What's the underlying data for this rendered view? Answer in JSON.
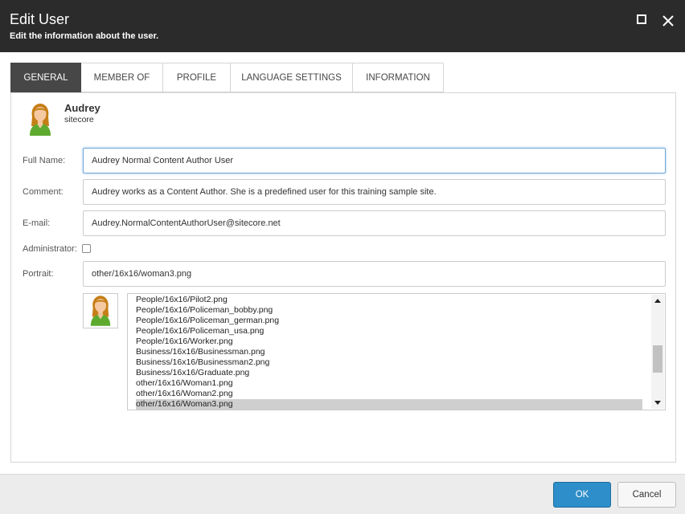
{
  "dialog": {
    "title": "Edit User",
    "subtitle": "Edit the information about the user."
  },
  "tabs": [
    {
      "label": "GENERAL",
      "active": true
    },
    {
      "label": "MEMBER OF"
    },
    {
      "label": "PROFILE"
    },
    {
      "label": "LANGUAGE SETTINGS"
    },
    {
      "label": "INFORMATION"
    }
  ],
  "user": {
    "name": "Audrey",
    "domain": "sitecore"
  },
  "form": {
    "full_name_label": "Full Name:",
    "full_name_value": "Audrey Normal Content Author User",
    "comment_label": "Comment:",
    "comment_value": "Audrey works as a Content Author. She is a predefined user for this training sample site.",
    "email_label": "E-mail:",
    "email_value": "Audrey.NormalContentAuthorUser@sitecore.net",
    "administrator_label": "Administrator:",
    "administrator_checked": false,
    "portrait_label": "Portrait:",
    "portrait_value": "other/16x16/woman3.png"
  },
  "portrait_list": {
    "items": [
      "People/16x16/Pilot2.png",
      "People/16x16/Policeman_bobby.png",
      "People/16x16/Policeman_german.png",
      "People/16x16/Policeman_usa.png",
      "People/16x16/Worker.png",
      "Business/16x16/Businessman.png",
      "Business/16x16/Businessman2.png",
      "Business/16x16/Graduate.png",
      "other/16x16/Woman1.png",
      "other/16x16/Woman2.png",
      "other/16x16/Woman3.png"
    ],
    "selected": "other/16x16/Woman3.png"
  },
  "footer": {
    "ok_label": "OK",
    "cancel_label": "Cancel"
  },
  "colors": {
    "header_bg": "#2b2b2b",
    "active_tab": "#474747",
    "ok_button": "#2d8ec9"
  }
}
